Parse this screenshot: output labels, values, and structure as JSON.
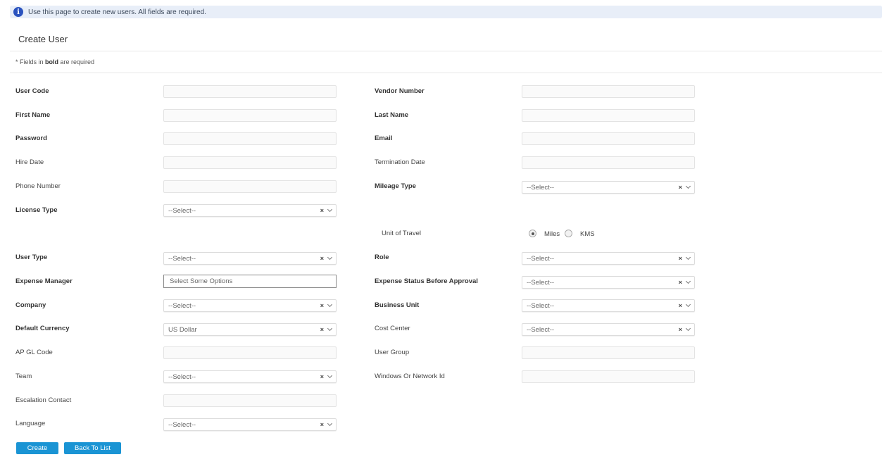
{
  "info": {
    "text": "Use this page to create new users. All fields are required."
  },
  "page": {
    "title": "Create User"
  },
  "required_note": {
    "prefix": "* Fields in ",
    "bold": "bold",
    "suffix": " are required"
  },
  "fields": {
    "user_code": {
      "label": "User Code",
      "value": ""
    },
    "vendor_number": {
      "label": "Vendor Number",
      "value": ""
    },
    "first_name": {
      "label": "First Name",
      "value": ""
    },
    "last_name": {
      "label": "Last Name",
      "value": ""
    },
    "password": {
      "label": "Password",
      "value": ""
    },
    "email": {
      "label": "Email",
      "value": ""
    },
    "hire_date": {
      "label": "Hire Date",
      "value": ""
    },
    "termination_date": {
      "label": "Termination Date",
      "value": ""
    },
    "phone_number": {
      "label": "Phone Number",
      "value": ""
    },
    "mileage_type": {
      "label": "Mileage Type",
      "value": "--Select--"
    },
    "license_type": {
      "label": "License Type",
      "value": "--Select--"
    },
    "unit_of_travel": {
      "label": "Unit of Travel",
      "options": [
        "Miles",
        "KMS"
      ],
      "selected": "Miles"
    },
    "user_type": {
      "label": "User Type",
      "value": "--Select--"
    },
    "role": {
      "label": "Role",
      "value": "--Select--"
    },
    "expense_manager": {
      "label": "Expense Manager",
      "placeholder": "Select Some Options"
    },
    "expense_status": {
      "label": "Expense Status Before Approval",
      "value": "--Select--"
    },
    "company": {
      "label": "Company",
      "value": "--Select--"
    },
    "business_unit": {
      "label": "Business Unit",
      "value": "--Select--"
    },
    "default_currency": {
      "label": "Default Currency",
      "value": "US Dollar"
    },
    "cost_center": {
      "label": "Cost Center",
      "value": "--Select--"
    },
    "ap_gl_code": {
      "label": "AP GL Code",
      "value": ""
    },
    "user_group": {
      "label": "User Group",
      "value": ""
    },
    "team": {
      "label": "Team",
      "value": "--Select--"
    },
    "windows_id": {
      "label": "Windows Or Network Id",
      "value": ""
    },
    "escalation_contact": {
      "label": "Escalation Contact",
      "value": ""
    },
    "language": {
      "label": "Language",
      "value": "--Select--"
    }
  },
  "select_clear_glyph": "×",
  "buttons": {
    "create": "Create",
    "back": "Back To List"
  },
  "colors": {
    "primary_button": "#1a94d4",
    "info_icon": "#2a52be",
    "info_bar": "#e8eef8"
  }
}
